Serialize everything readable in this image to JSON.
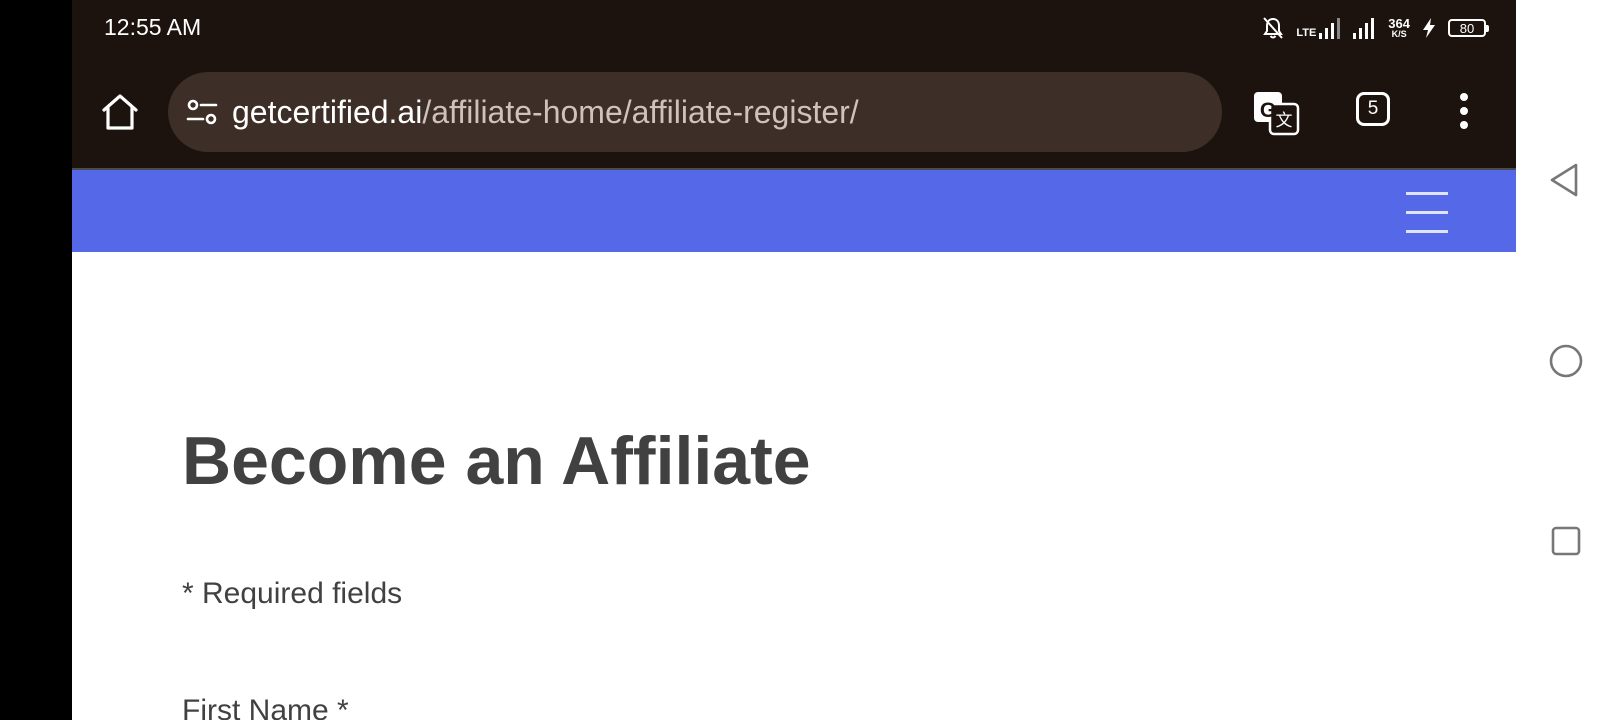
{
  "status_bar": {
    "time": "12:55 AM",
    "network_label": "LTE",
    "speed_value": "364",
    "speed_unit": "K/S",
    "battery_level": "80"
  },
  "browser": {
    "url_domain": "getcertified.ai",
    "url_path": "/affiliate-home/affiliate-register/",
    "tab_count": "5",
    "icons": {
      "home": "home-icon",
      "site_settings": "tune-icon",
      "translate": "translate-icon",
      "menu": "more-vert-icon"
    }
  },
  "site": {
    "nav_color": "#5568e7",
    "menu_icon": "hamburger-icon"
  },
  "page": {
    "title": "Become an Affiliate",
    "required_note": "* Required fields",
    "first_name_label": "First Name *"
  },
  "system_nav": {
    "back_icon": "triangle-back-icon",
    "home_icon": "circle-home-icon",
    "recents_icon": "square-recents-icon"
  }
}
